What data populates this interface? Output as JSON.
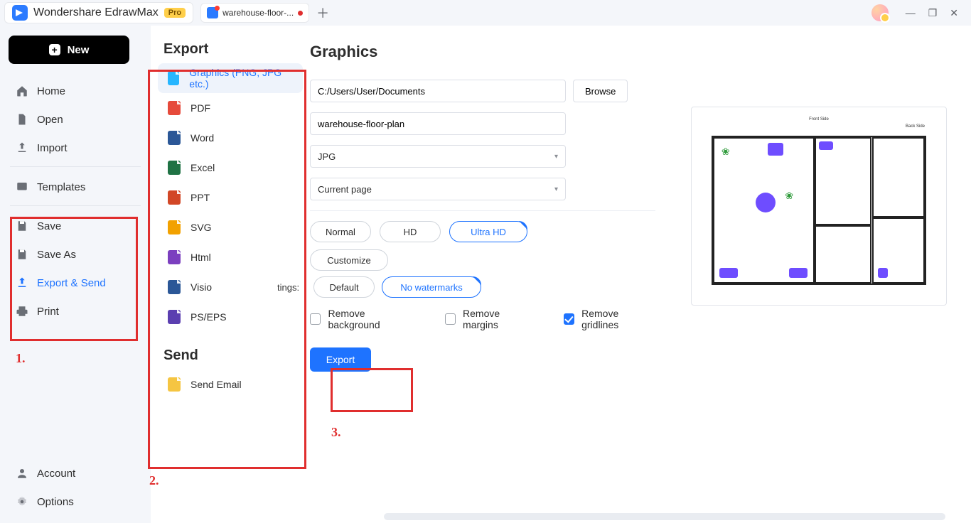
{
  "app": {
    "name": "Wondershare EdrawMax",
    "badge": "Pro",
    "document_tab": "warehouse-floor-...",
    "new_button": "New"
  },
  "window_controls": {
    "minimize": "—",
    "maximize": "❐",
    "close": "✕"
  },
  "top_icons": [
    "bell",
    "help",
    "grid",
    "shirt",
    "gear"
  ],
  "sidebar": {
    "items": [
      {
        "key": "home",
        "label": "Home"
      },
      {
        "key": "open",
        "label": "Open"
      },
      {
        "key": "import",
        "label": "Import"
      },
      {
        "key": "templates",
        "label": "Templates"
      },
      {
        "key": "save",
        "label": "Save"
      },
      {
        "key": "saveas",
        "label": "Save As"
      },
      {
        "key": "exportsend",
        "label": "Export & Send",
        "selected": true
      },
      {
        "key": "print",
        "label": "Print"
      }
    ],
    "footer": [
      {
        "key": "account",
        "label": "Account"
      },
      {
        "key": "options",
        "label": "Options"
      }
    ]
  },
  "export_panel": {
    "heading_export": "Export",
    "heading_send": "Send",
    "formats": [
      {
        "key": "graphics",
        "label": "Graphics (PNG, JPG etc.)",
        "color": "#27b6ff",
        "selected": true
      },
      {
        "key": "pdf",
        "label": "PDF",
        "color": "#e64a3b"
      },
      {
        "key": "word",
        "label": "Word",
        "color": "#2b5797"
      },
      {
        "key": "excel",
        "label": "Excel",
        "color": "#1f7244"
      },
      {
        "key": "ppt",
        "label": "PPT",
        "color": "#d24726"
      },
      {
        "key": "svg",
        "label": "SVG",
        "color": "#f2a100"
      },
      {
        "key": "html",
        "label": "Html",
        "color": "#7b3fbf"
      },
      {
        "key": "visio",
        "label": "Visio",
        "color": "#2b5797"
      },
      {
        "key": "pseps",
        "label": "PS/EPS",
        "color": "#5b3fb0"
      }
    ],
    "send_items": [
      {
        "key": "email",
        "label": "Send Email",
        "color": "#f5c542"
      }
    ]
  },
  "form": {
    "title": "Graphics",
    "path": "C:/Users/User/Documents",
    "browse": "Browse",
    "filename": "warehouse-floor-plan",
    "filetype": "JPG",
    "scope": "Current page",
    "quality": {
      "options": [
        "Normal",
        "HD",
        "Ultra HD"
      ],
      "active": "Ultra HD",
      "customize": "Customize"
    },
    "settings_label": "tings:",
    "watermark": {
      "options": [
        "Default",
        "No watermarks"
      ],
      "active": "No watermarks"
    },
    "checks": {
      "remove_bg": {
        "label": "Remove background",
        "checked": false
      },
      "remove_margins": {
        "label": "Remove margins",
        "checked": false
      },
      "remove_gridlines": {
        "label": "Remove gridlines",
        "checked": true
      }
    },
    "export_button": "Export"
  },
  "callouts": {
    "c1": "1.",
    "c2": "2.",
    "c3": "3."
  }
}
